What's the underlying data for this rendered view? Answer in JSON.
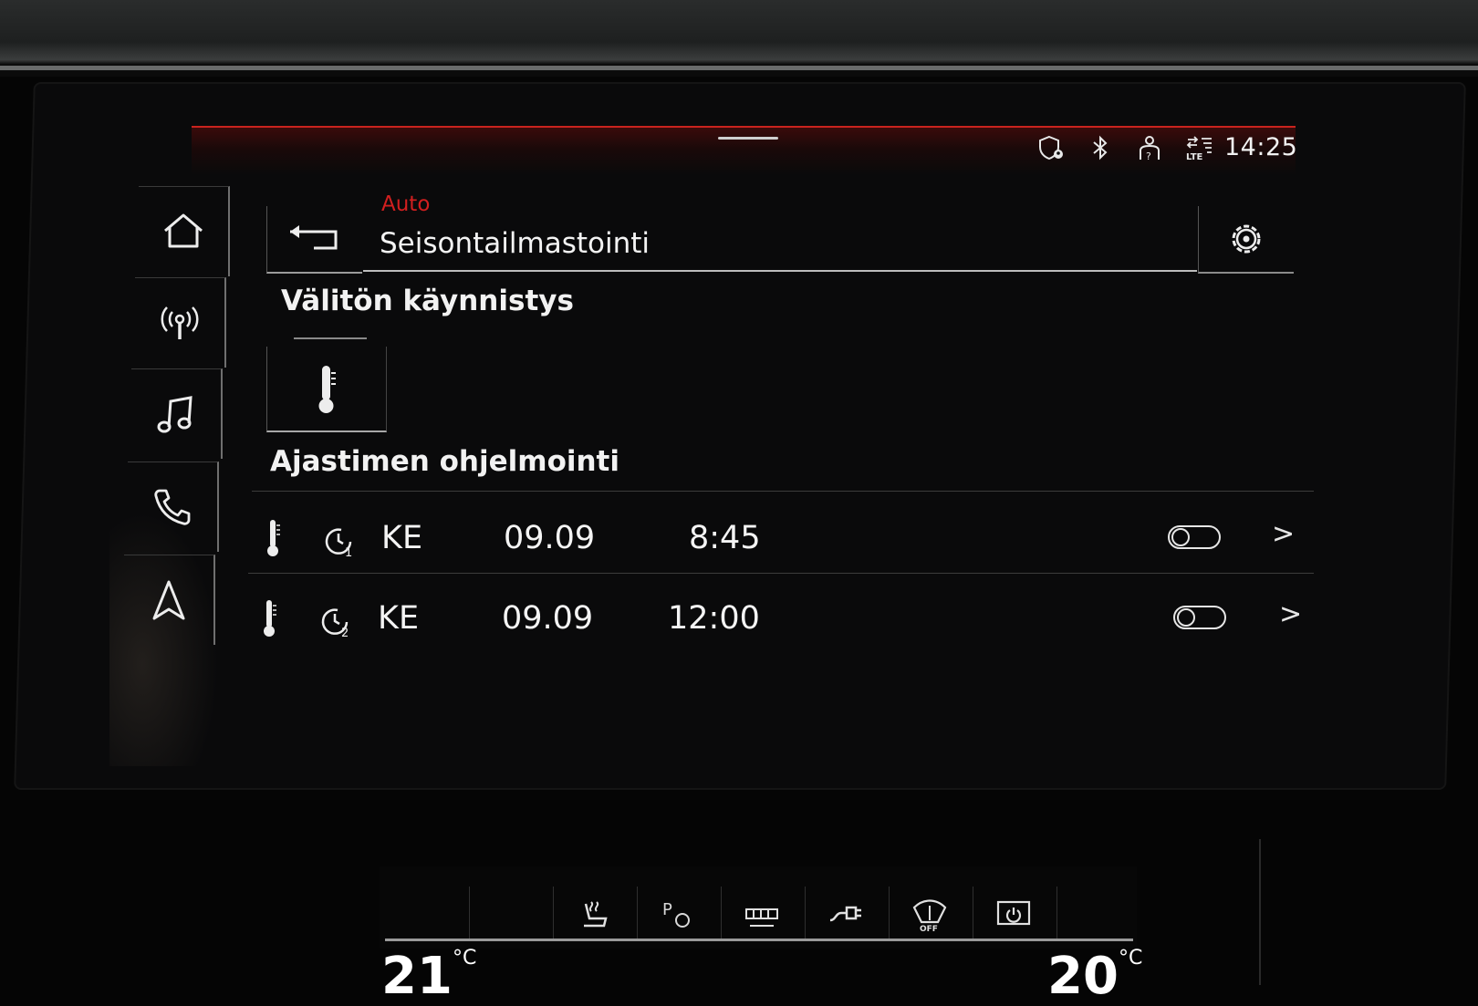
{
  "status_bar": {
    "time": "14:25",
    "icons": [
      "shield-location-icon",
      "bluetooth-icon",
      "person-question-icon",
      "lte-signal-icon"
    ]
  },
  "sidebar": {
    "items": [
      {
        "icon": "home-icon"
      },
      {
        "icon": "radio-antenna-icon"
      },
      {
        "icon": "music-note-icon"
      },
      {
        "icon": "phone-icon"
      },
      {
        "icon": "navigation-arrow-icon"
      }
    ]
  },
  "header": {
    "breadcrumb": "Auto",
    "title": "Seisontailmastointi"
  },
  "immediate_start": {
    "title": "Välitön käynnistys"
  },
  "timer_programming": {
    "title": "Ajastimen ohjelmointi",
    "timers": [
      {
        "timer_number": "1",
        "day": "KE",
        "date": "09.09",
        "time": "8:45",
        "enabled": false
      },
      {
        "timer_number": "2",
        "day": "KE",
        "date": "09.09",
        "time": "12:00",
        "enabled": false
      }
    ]
  },
  "climate_panel": {
    "left_temp": "21",
    "right_temp": "20",
    "unit": "°C",
    "buttons": [
      "heated-seat-icon",
      "park-climate-icon",
      "rear-defrost-icon",
      "charging-plug-icon",
      "wiper-off-icon",
      "power-screen-icon"
    ]
  },
  "colors": {
    "accent_red": "#d21f1f",
    "text": "#f2f2f2",
    "background": "#0a0a0b"
  }
}
